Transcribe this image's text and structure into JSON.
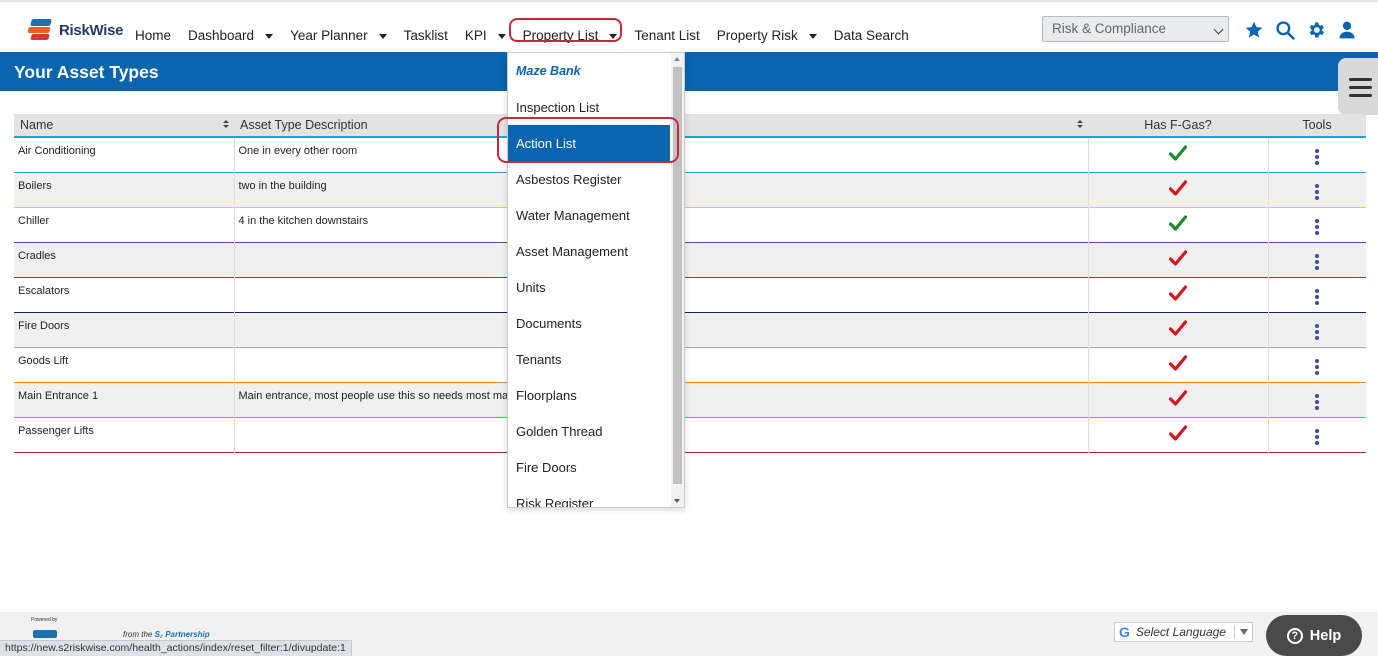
{
  "app": {
    "name": "RiskWise"
  },
  "nav": {
    "items": [
      {
        "label": "Home",
        "dropdown": false
      },
      {
        "label": "Dashboard",
        "dropdown": true
      },
      {
        "label": "Year Planner",
        "dropdown": true
      },
      {
        "label": "Tasklist",
        "dropdown": false
      },
      {
        "label": "KPI",
        "dropdown": true
      },
      {
        "label": "Property List",
        "dropdown": true
      },
      {
        "label": "Tenant List",
        "dropdown": false
      },
      {
        "label": "Property Risk",
        "dropdown": true
      },
      {
        "label": "Data Search",
        "dropdown": false
      }
    ],
    "module_select": "Risk & Compliance",
    "icons": [
      "star-icon",
      "search-icon",
      "gear-icon",
      "user-icon"
    ]
  },
  "page": {
    "title": "Your Asset Types"
  },
  "table": {
    "columns": [
      "Name",
      "Asset Type Description",
      "Has F-Gas?",
      "Tools"
    ],
    "rows": [
      {
        "name": "Air Conditioning",
        "description": "One in every other room",
        "fgas": true,
        "line_color": "#2b9fd8"
      },
      {
        "name": "Boilers",
        "description": "two in the building",
        "fgas": false,
        "line_color": "#f2d21b"
      },
      {
        "name": "Chiller",
        "description": "4 in the kitchen downstairs",
        "fgas": true,
        "line_color": "#6b3fa0"
      },
      {
        "name": "Cradles",
        "description": "",
        "fgas": false,
        "line_color": "#1a7a2a"
      },
      {
        "name": "Escalators",
        "description": "",
        "fgas": false,
        "line_color": "#1a1a6e"
      },
      {
        "name": "Fire Doors",
        "description": "",
        "fgas": false,
        "line_color": "#aaaaaa"
      },
      {
        "name": "Goods Lift",
        "description": "",
        "fgas": false,
        "line_color": "#f08a1c"
      },
      {
        "name": "Main Entrance 1",
        "description": "Main entrance, most people use this so needs most main",
        "fgas": false,
        "line_color": "#3ad43a"
      },
      {
        "name": "Passenger Lifts",
        "description": "",
        "fgas": false,
        "line_color": "#b5252a"
      }
    ]
  },
  "dropdown": {
    "heading": "Maze Bank",
    "items": [
      "Inspection List",
      "Action List",
      "Asbestos Register",
      "Water Management",
      "Asset Management",
      "Units",
      "Documents",
      "Tenants",
      "Floorplans",
      "Golden Thread",
      "Fire Doors",
      "Risk Register"
    ],
    "active": "Action List"
  },
  "footer": {
    "powered": "Powered by",
    "from": "from the",
    "partnership": "S₂ Partnership",
    "language": "Select Language",
    "help": "Help",
    "status_url": "https://new.s2riskwise.com/health_actions/index/reset_filter:1/divupdate:1"
  },
  "colors": {
    "brand": "#0b64ae",
    "check_true": "#1e8a2e",
    "check_false": "#d4161e",
    "highlight": "#c52a3a"
  }
}
